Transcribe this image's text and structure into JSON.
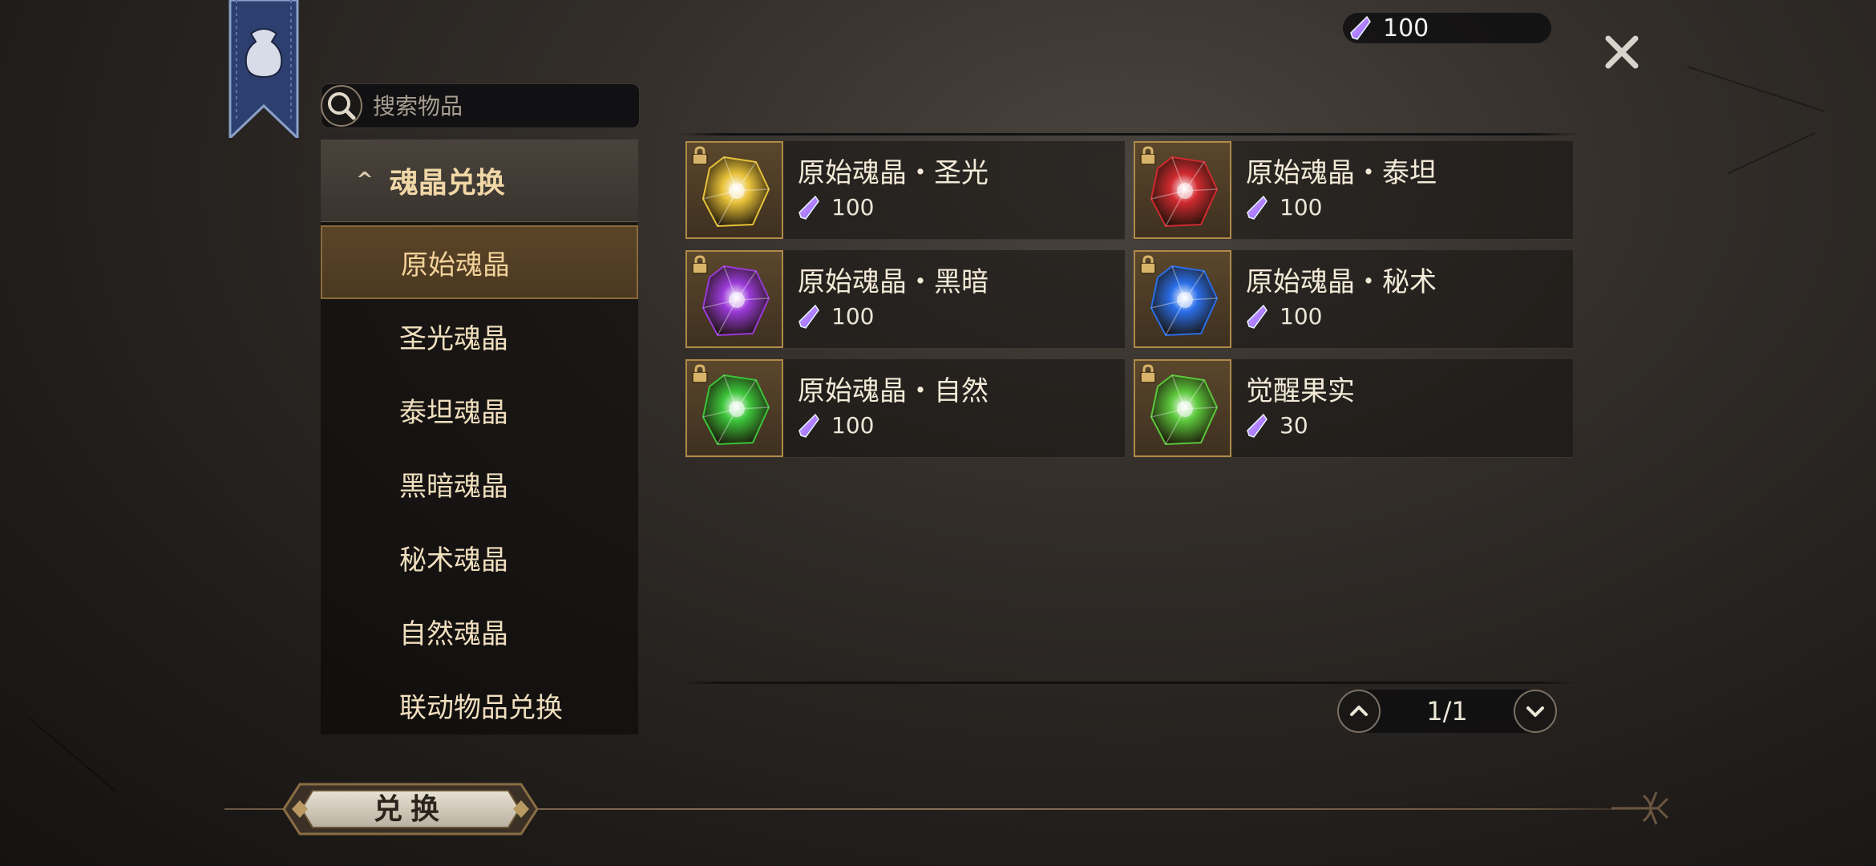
{
  "currency": {
    "value": "100",
    "icon": "soul-gem-icon"
  },
  "search": {
    "placeholder": "搜索物品"
  },
  "sidebar": {
    "header": "魂晶兑换",
    "items": [
      {
        "label": "原始魂晶",
        "active": true
      },
      {
        "label": "圣光魂晶"
      },
      {
        "label": "泰坦魂晶"
      },
      {
        "label": "黑暗魂晶"
      },
      {
        "label": "秘术魂晶"
      },
      {
        "label": "自然魂晶"
      },
      {
        "label": "联动物品兑换"
      }
    ]
  },
  "items": [
    {
      "name": "原始魂晶・圣光",
      "price": "100",
      "color": "#e8c23a",
      "icon": "holy-crystal-icon"
    },
    {
      "name": "原始魂晶・泰坦",
      "price": "100",
      "color": "#d02a30",
      "icon": "titan-crystal-icon"
    },
    {
      "name": "原始魂晶・黑暗",
      "price": "100",
      "color": "#9a3ad8",
      "icon": "dark-crystal-icon"
    },
    {
      "name": "原始魂晶・秘术",
      "price": "100",
      "color": "#2a6ee8",
      "icon": "arcane-crystal-icon"
    },
    {
      "name": "原始魂晶・自然",
      "price": "100",
      "color": "#3cc43a",
      "icon": "nature-crystal-icon"
    },
    {
      "name": "觉醒果实",
      "price": "30",
      "color": "#5cc83c",
      "icon": "awakening-fruit-icon"
    }
  ],
  "pagination": {
    "text": "1/1"
  },
  "exchange_button": {
    "label": "兑换"
  }
}
